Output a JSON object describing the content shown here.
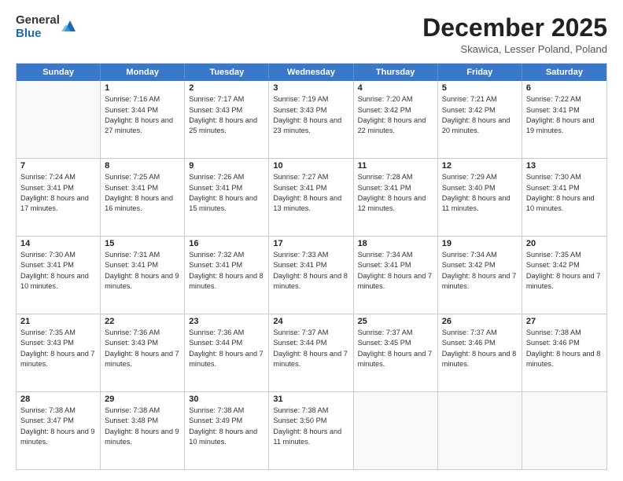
{
  "logo": {
    "general": "General",
    "blue": "Blue"
  },
  "title": "December 2025",
  "location": "Skawica, Lesser Poland, Poland",
  "weekdays": [
    "Sunday",
    "Monday",
    "Tuesday",
    "Wednesday",
    "Thursday",
    "Friday",
    "Saturday"
  ],
  "weeks": [
    [
      {
        "day": "",
        "empty": true
      },
      {
        "day": "1",
        "sunrise": "7:16 AM",
        "sunset": "3:44 PM",
        "daylight": "8 hours and 27 minutes."
      },
      {
        "day": "2",
        "sunrise": "7:17 AM",
        "sunset": "3:43 PM",
        "daylight": "8 hours and 25 minutes."
      },
      {
        "day": "3",
        "sunrise": "7:19 AM",
        "sunset": "3:43 PM",
        "daylight": "8 hours and 23 minutes."
      },
      {
        "day": "4",
        "sunrise": "7:20 AM",
        "sunset": "3:42 PM",
        "daylight": "8 hours and 22 minutes."
      },
      {
        "day": "5",
        "sunrise": "7:21 AM",
        "sunset": "3:42 PM",
        "daylight": "8 hours and 20 minutes."
      },
      {
        "day": "6",
        "sunrise": "7:22 AM",
        "sunset": "3:41 PM",
        "daylight": "8 hours and 19 minutes."
      }
    ],
    [
      {
        "day": "7",
        "sunrise": "7:24 AM",
        "sunset": "3:41 PM",
        "daylight": "8 hours and 17 minutes."
      },
      {
        "day": "8",
        "sunrise": "7:25 AM",
        "sunset": "3:41 PM",
        "daylight": "8 hours and 16 minutes."
      },
      {
        "day": "9",
        "sunrise": "7:26 AM",
        "sunset": "3:41 PM",
        "daylight": "8 hours and 15 minutes."
      },
      {
        "day": "10",
        "sunrise": "7:27 AM",
        "sunset": "3:41 PM",
        "daylight": "8 hours and 13 minutes."
      },
      {
        "day": "11",
        "sunrise": "7:28 AM",
        "sunset": "3:41 PM",
        "daylight": "8 hours and 12 minutes."
      },
      {
        "day": "12",
        "sunrise": "7:29 AM",
        "sunset": "3:40 PM",
        "daylight": "8 hours and 11 minutes."
      },
      {
        "day": "13",
        "sunrise": "7:30 AM",
        "sunset": "3:41 PM",
        "daylight": "8 hours and 10 minutes."
      }
    ],
    [
      {
        "day": "14",
        "sunrise": "7:30 AM",
        "sunset": "3:41 PM",
        "daylight": "8 hours and 10 minutes."
      },
      {
        "day": "15",
        "sunrise": "7:31 AM",
        "sunset": "3:41 PM",
        "daylight": "8 hours and 9 minutes."
      },
      {
        "day": "16",
        "sunrise": "7:32 AM",
        "sunset": "3:41 PM",
        "daylight": "8 hours and 8 minutes."
      },
      {
        "day": "17",
        "sunrise": "7:33 AM",
        "sunset": "3:41 PM",
        "daylight": "8 hours and 8 minutes."
      },
      {
        "day": "18",
        "sunrise": "7:34 AM",
        "sunset": "3:41 PM",
        "daylight": "8 hours and 7 minutes."
      },
      {
        "day": "19",
        "sunrise": "7:34 AM",
        "sunset": "3:42 PM",
        "daylight": "8 hours and 7 minutes."
      },
      {
        "day": "20",
        "sunrise": "7:35 AM",
        "sunset": "3:42 PM",
        "daylight": "8 hours and 7 minutes."
      }
    ],
    [
      {
        "day": "21",
        "sunrise": "7:35 AM",
        "sunset": "3:43 PM",
        "daylight": "8 hours and 7 minutes."
      },
      {
        "day": "22",
        "sunrise": "7:36 AM",
        "sunset": "3:43 PM",
        "daylight": "8 hours and 7 minutes."
      },
      {
        "day": "23",
        "sunrise": "7:36 AM",
        "sunset": "3:44 PM",
        "daylight": "8 hours and 7 minutes."
      },
      {
        "day": "24",
        "sunrise": "7:37 AM",
        "sunset": "3:44 PM",
        "daylight": "8 hours and 7 minutes."
      },
      {
        "day": "25",
        "sunrise": "7:37 AM",
        "sunset": "3:45 PM",
        "daylight": "8 hours and 7 minutes."
      },
      {
        "day": "26",
        "sunrise": "7:37 AM",
        "sunset": "3:46 PM",
        "daylight": "8 hours and 8 minutes."
      },
      {
        "day": "27",
        "sunrise": "7:38 AM",
        "sunset": "3:46 PM",
        "daylight": "8 hours and 8 minutes."
      }
    ],
    [
      {
        "day": "28",
        "sunrise": "7:38 AM",
        "sunset": "3:47 PM",
        "daylight": "8 hours and 9 minutes."
      },
      {
        "day": "29",
        "sunrise": "7:38 AM",
        "sunset": "3:48 PM",
        "daylight": "8 hours and 9 minutes."
      },
      {
        "day": "30",
        "sunrise": "7:38 AM",
        "sunset": "3:49 PM",
        "daylight": "8 hours and 10 minutes."
      },
      {
        "day": "31",
        "sunrise": "7:38 AM",
        "sunset": "3:50 PM",
        "daylight": "8 hours and 11 minutes."
      },
      {
        "day": "",
        "empty": true
      },
      {
        "day": "",
        "empty": true
      },
      {
        "day": "",
        "empty": true
      }
    ]
  ]
}
